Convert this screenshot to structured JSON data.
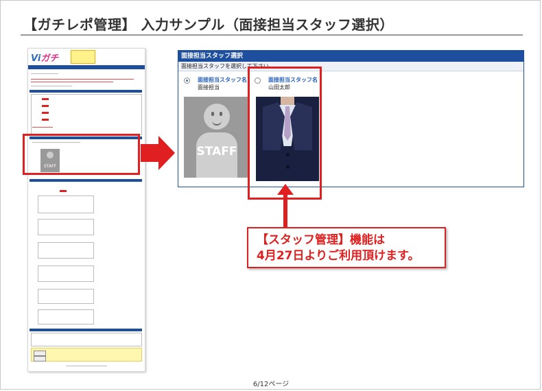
{
  "slide": {
    "title": "【ガチレポ管理】 入力サンプル（面接担当スタッフ選択）",
    "page_number": "6/12ページ"
  },
  "thumbnail": {
    "logo_part1": "Vi",
    "logo_part2": "ガチ"
  },
  "panel": {
    "header": "面接担当スタッフ選択",
    "instruction": "面接担当スタッフを選択して下さい",
    "staff": [
      {
        "label": "面接担当スタッフ名",
        "name": "面接担当",
        "selected": true,
        "photo": "staff-placeholder-icon"
      },
      {
        "label": "面接担当スタッフ名",
        "name": "山田太郎",
        "selected": false,
        "photo": "suit-photo"
      }
    ],
    "placeholder_text": "STAFF"
  },
  "callout": {
    "line1": "【スタッフ管理】機能は",
    "line2": "4月27日よりご利用頂けます。"
  },
  "colors": {
    "highlight": "#e02020",
    "panel_blue": "#1e4f9e",
    "label_blue": "#2760b8"
  }
}
